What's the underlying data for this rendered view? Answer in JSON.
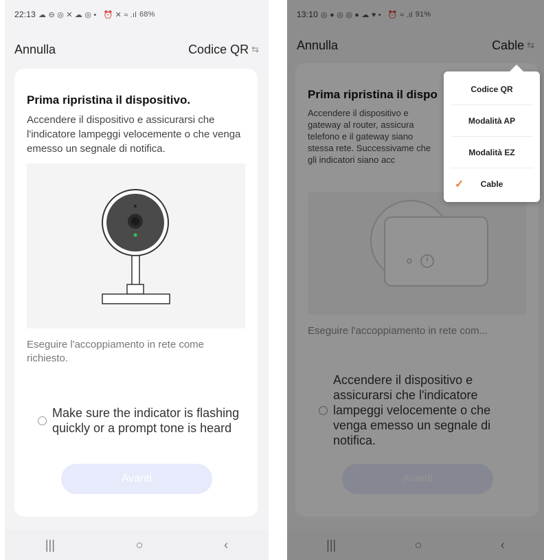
{
  "screen1": {
    "status": {
      "time": "22:13",
      "icons": "☁ ⊖ ◎ ✕ ☁ ◎ •",
      "right_icons": "⏰ ✕ ≈ .ıl",
      "battery": "68%"
    },
    "header": {
      "cancel": "Annulla",
      "mode": "Codice QR"
    },
    "title": "Prima ripristina il dispositivo.",
    "description": "Accendere il dispositivo e assicurarsi che l'indicatore lampeggi velocemente o che venga emesso un segnale di notifica.",
    "hint": "Eseguire l'accoppiamento in rete come richiesto.",
    "checkbox_label": "Make sure the indicator is flashing quickly or a prompt tone is heard",
    "next": "Avanti"
  },
  "screen2": {
    "status": {
      "time": "13:10",
      "icons": "◎ ● ◎ ◎ ● ☁ ♥ •",
      "right_icons": "⏰ ≈ .ıl",
      "battery": "91%"
    },
    "header": {
      "cancel": "Annulla",
      "mode": "Cable"
    },
    "title": "Prima ripristina il dispo",
    "description": "Accendere il dispositivo e gateway al router, assicura telefono e il gateway siano stessa rete. Successivame che gli indicatori siano acc",
    "hint": "Eseguire l'accoppiamento in rete com...",
    "checkbox_label": "Accendere il dispositivo e assicurarsi che l'indicatore lampeggi velocemente o che venga emesso un segnale di notifica.",
    "next": "Avanti",
    "dropdown": [
      {
        "label": "Codice QR",
        "selected": false
      },
      {
        "label": "Modalità AP",
        "selected": false
      },
      {
        "label": "Modalità EZ",
        "selected": false
      },
      {
        "label": "Cable",
        "selected": true
      }
    ]
  },
  "nav": {
    "recent": "|||",
    "home": "○",
    "back": "‹"
  }
}
